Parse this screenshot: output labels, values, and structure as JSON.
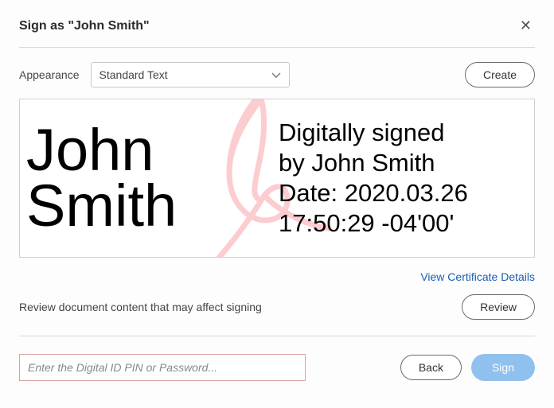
{
  "dialog": {
    "title": "Sign as \"John Smith\""
  },
  "appearance": {
    "label": "Appearance",
    "selected": "Standard Text",
    "create_label": "Create"
  },
  "preview": {
    "name_display": "John\nSmith",
    "details": "Digitally signed\nby John Smith\nDate: 2020.03.26\n17:50:29 -04'00'"
  },
  "links": {
    "view_cert": "View Certificate Details"
  },
  "review": {
    "message": "Review document content that may affect signing",
    "button": "Review"
  },
  "footer": {
    "pin_placeholder": "Enter the Digital ID PIN or Password...",
    "back": "Back",
    "sign": "Sign"
  }
}
